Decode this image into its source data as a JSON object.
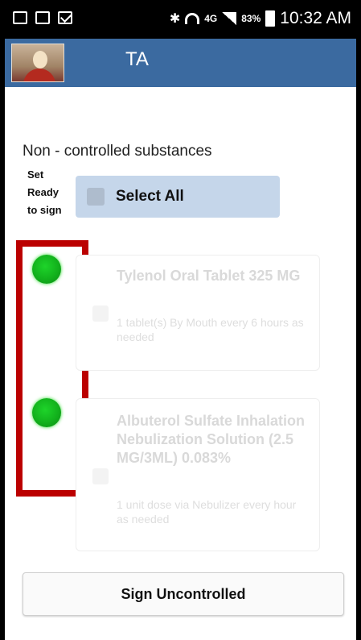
{
  "status_bar": {
    "network": "4G",
    "battery": "83%",
    "time": "10:32 AM"
  },
  "header": {
    "title": "TA"
  },
  "section": {
    "title": "Non - controlled substances",
    "ready_label": "Set Ready to sign",
    "select_all": "Select All"
  },
  "medications": [
    {
      "name": "Tylenol Oral Tablet 325 MG",
      "sig": "1 tablet(s) By Mouth every 6 hours as needed",
      "ready": true
    },
    {
      "name": "Albuterol Sulfate Inhalation Nebulization Solution (2.5 MG/3ML) 0.083%",
      "sig": "1 unit dose via Nebulizer every hour as needed",
      "ready": true
    }
  ],
  "actions": {
    "sign": "Sign Uncontrolled"
  },
  "colors": {
    "header": "#3b6aa0",
    "select_all_bg": "#c5d6ea",
    "ready_indicator": "#12b11c",
    "highlight_box": "#bb0000"
  }
}
